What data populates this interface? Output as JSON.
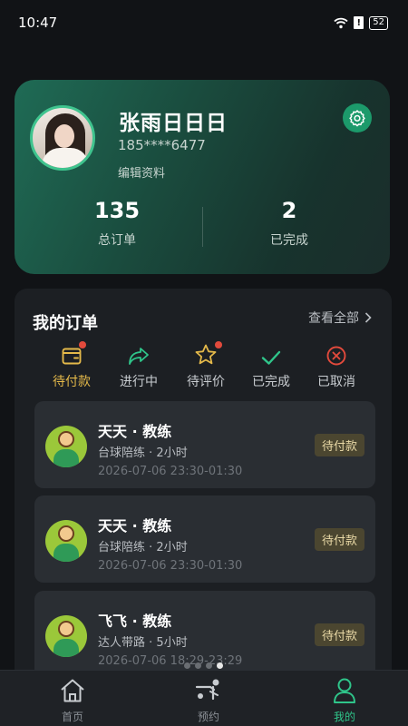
{
  "status_bar": {
    "time": "10:47",
    "battery": "52"
  },
  "profile": {
    "name": "张雨日日日",
    "phone": "185****6477",
    "edit_label": "编辑资料",
    "stats": [
      {
        "value": "135",
        "label": "总订单"
      },
      {
        "value": "2",
        "label": "已完成"
      }
    ]
  },
  "orders": {
    "title": "我的订单",
    "view_all": "查看全部",
    "tabs": [
      {
        "label": "待付款",
        "icon": "wallet-icon",
        "active": true,
        "has_dot": true
      },
      {
        "label": "进行中",
        "icon": "share-arrow-icon",
        "active": false,
        "has_dot": false
      },
      {
        "label": "待评价",
        "icon": "star-icon",
        "active": false,
        "has_dot": true
      },
      {
        "label": "已完成",
        "icon": "check-icon",
        "active": false,
        "has_dot": false
      },
      {
        "label": "已取消",
        "icon": "cancel-circle-icon",
        "active": false,
        "has_dot": false
      }
    ],
    "list": [
      {
        "name": "天天 · 教练",
        "service": "台球陪练",
        "duration": "2小时",
        "time": "2026-07-06 23:30-01:30",
        "status": "待付款"
      },
      {
        "name": "天天 · 教练",
        "service": "台球陪练",
        "duration": "2小时",
        "time": "2026-07-06 23:30-01:30",
        "status": "待付款"
      },
      {
        "name": "飞飞 · 教练",
        "service": "达人带路",
        "duration": "5小时",
        "time": "2026-07-06 18:29-23:29",
        "status": "待付款"
      }
    ]
  },
  "nav": [
    {
      "label": "首页",
      "icon": "home-icon",
      "active": false
    },
    {
      "label": "预约",
      "icon": "billiards-icon",
      "active": false
    },
    {
      "label": "我的",
      "icon": "person-icon",
      "active": true
    }
  ],
  "colors": {
    "accent": "#2fc58a",
    "pending": "#e4b94a",
    "background": "#111316"
  }
}
